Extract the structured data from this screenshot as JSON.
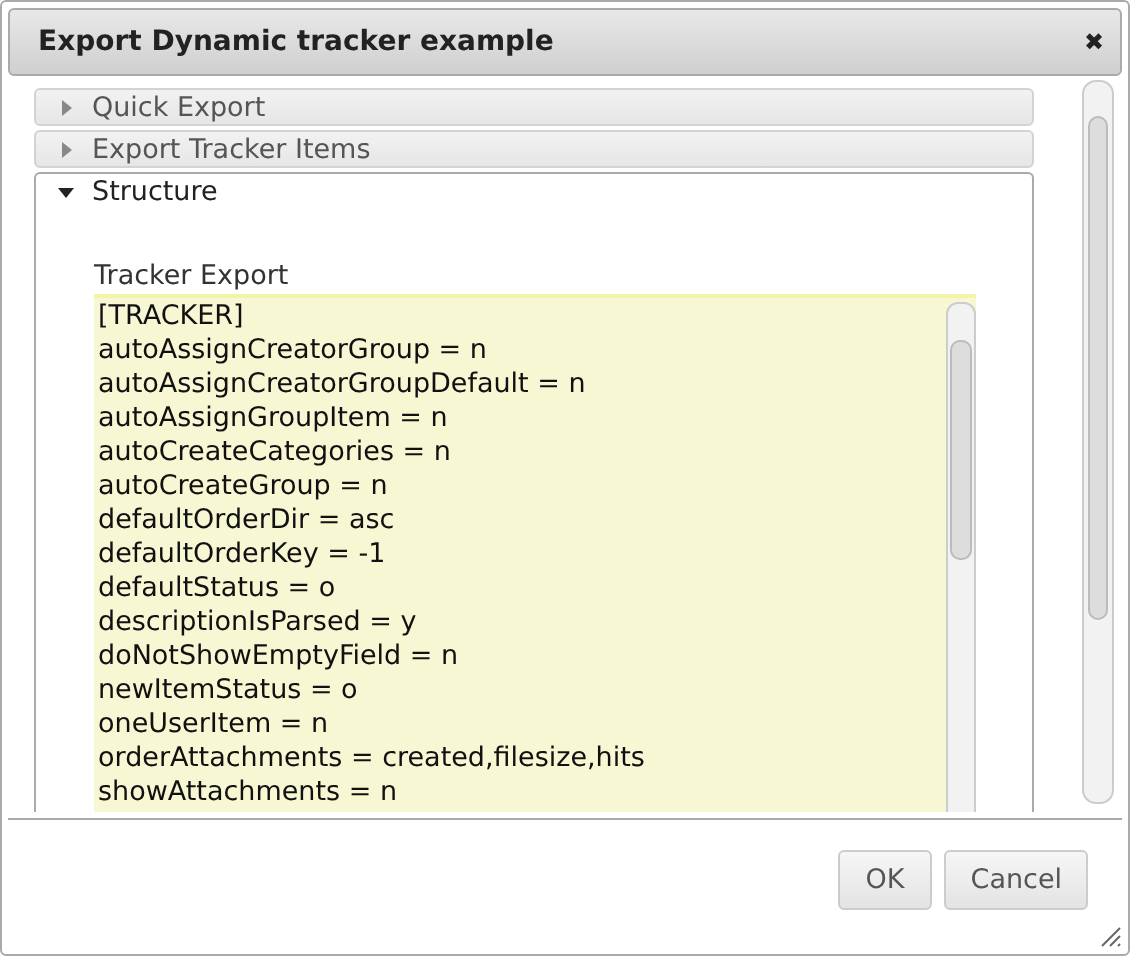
{
  "dialog": {
    "title": "Export Dynamic tracker example",
    "close": "✖"
  },
  "sections": [
    {
      "label": "Quick Export",
      "expanded": false
    },
    {
      "label": "Export Tracker Items",
      "expanded": false
    },
    {
      "label": "Structure",
      "expanded": true
    }
  ],
  "export": {
    "label": "Tracker Export",
    "lines": [
      "[TRACKER]",
      "autoAssignCreatorGroup = n",
      "autoAssignCreatorGroupDefault = n",
      "autoAssignGroupItem = n",
      "autoCreateCategories = n",
      "autoCreateGroup = n",
      "defaultOrderDir = asc",
      "defaultOrderKey = -1",
      "defaultStatus = o",
      "descriptionIsParsed = y",
      "doNotShowEmptyField = n",
      "newItemStatus = o",
      "oneUserItem = n",
      "orderAttachments = created,filesize,hits",
      "showAttachments = n"
    ]
  },
  "buttons": [
    "OK",
    "Cancel"
  ]
}
